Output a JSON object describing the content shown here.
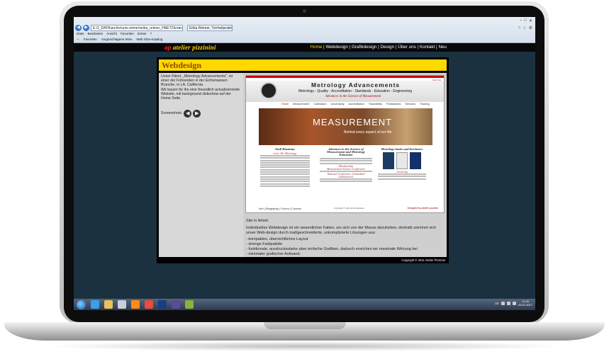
{
  "browser": {
    "address": "E:\\1_DATA\\archiv\\unis.reimer\\erika_reimer_HNETZ\\index.htm",
    "tab_title": "Erika Reimer, Tierheilpraktikerin",
    "menu": [
      "Datei",
      "Bearbeiten",
      "Ansicht",
      "Favoriten",
      "Extras",
      "?"
    ],
    "favorites": [
      "Favoriten",
      "Vorgeschlagene Sites",
      "Web Slice-Katalog"
    ]
  },
  "site": {
    "logo_prefix": "ap ",
    "logo_main": "atelier pizzinini",
    "nav": [
      "Home",
      "Webdesign",
      "Grafikdesign",
      "Design",
      "Über uns",
      "Kontakt",
      "Neu"
    ],
    "nav_active": "Home",
    "page_title": "Webdesign",
    "client_text_1": "Unser Klient, „Metrology Advancements\", ist einer der Führenden in der Eichenwesen Branche, in LA, California.",
    "client_text_2": "Wir bauen für ihn eine freundlich actualisierende Website, mit background slideshow auf der Home Seite.",
    "screenshots_label": "Screenshots:",
    "prev_arrow": "◀",
    "next_arrow": "▶",
    "copyright": "Copyright © 2011 Atelier Pizzinini"
  },
  "preview": {
    "lang": "DE EN",
    "title": "Metrology Advancements",
    "subtitle": "Metrology - Quality - Accreditation - Standards - Education - Engineering",
    "slogan": "Advances in the Science of Measurement",
    "nav": [
      "Home",
      "Measurement",
      "Calibration",
      "Uncertainty",
      "Accreditation",
      "Traceability",
      "Publications",
      "Services",
      "Training"
    ],
    "banner_big": "MEASUREMENT",
    "banner_small": "Behind every aspect of our life",
    "col1_title": "Emil Hazarian",
    "col1_sub": "a.k.a. Mr. Metrology",
    "col2_title": "Advances in the Science of Measurement and Metrology Education",
    "col2_heading": "Membership",
    "col2_sub1": "Measurement Science Conference",
    "col2_sub2": "National Conference of Standard Laboratories",
    "col3_title": "Metrology books and brochures",
    "col3_heading": "Lecturing",
    "footer_links": [
      "Info",
      "Biography",
      "Forum",
      "Contact"
    ],
    "footer_copy": "Copyright © 2011 Emil Hazarian",
    "footer_design": "Designed by atelier pizzinini"
  },
  "description": {
    "heading": "Site in Arbeit.",
    "paragraph": "Individuelles Webdesign ist ein wesentlicher Faktor, um sich von der Masse abzuheben, deshalb zeichnet sich unser Web-design durch maßgeschneiderte, unkomplizierte Lösungen aus:",
    "bullets": [
      "- kompaktes, übersichtliches Layout",
      "- strenge Farbpalette",
      "- funktionale, ausdrucksstarke aber einfache Grafiken, dadurch erreichen wir maximale Wirkung bei",
      "- minimaler grafischer Aufwand."
    ]
  },
  "taskbar": {
    "time": "11:26",
    "date": "03.01.2017",
    "lang": "DE"
  },
  "colors": {
    "nav_active": "#ffd400",
    "title_bar": "#ffd800",
    "logo_red": "#ff2a1a",
    "screen_bg": "#1b3140"
  }
}
